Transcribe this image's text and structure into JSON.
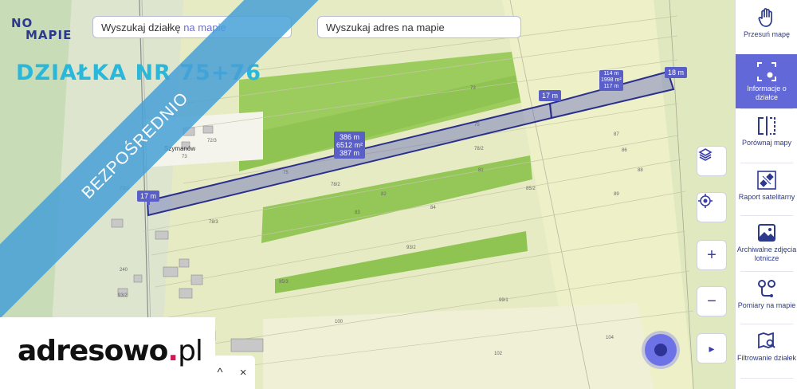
{
  "logo": {
    "line1": "NO",
    "line2": "MAPIE"
  },
  "search_parcel": {
    "prefix": "Wyszukaj działkę ",
    "highlight": "na mapie"
  },
  "search_address": {
    "text": "Wyszukaj adres na mapie"
  },
  "title": "DZIAŁKA NR 75+76",
  "ribbon": "BEZPOŚREDNIO",
  "place_name": "Szymanów",
  "measure_labels": {
    "left_edge": "17 m",
    "mid_edge": "17 m",
    "right_edge": "18 m",
    "parcel_a": [
      "386 m",
      "6512 m²",
      "387 m"
    ],
    "parcel_b": [
      "114 m",
      "1998 m²",
      "117 m"
    ]
  },
  "parcel_numbers": [
    "75",
    "76",
    "77",
    "78/2",
    "79",
    "80/2",
    "81",
    "82",
    "83",
    "84",
    "72/3",
    "73",
    "74",
    "73/2",
    "78/3",
    "85/2",
    "86",
    "87",
    "88",
    "89",
    "90",
    "240",
    "93/2",
    "95/3",
    "100",
    "102",
    "104"
  ],
  "map_controls": {
    "layers": "layers-icon",
    "locate": "locate-icon",
    "zoom_in": "+",
    "zoom_out": "−",
    "expand": "▸"
  },
  "brand": {
    "name": "adresowo",
    "dot": ".",
    "tld": "pl"
  },
  "mini_panel": {
    "up": "^",
    "close": "×"
  },
  "sidebar": {
    "items": [
      {
        "label": "Przesuń mapę",
        "icon": "hand-icon"
      },
      {
        "label": "Informacje o działce",
        "icon": "parcel-info-icon"
      },
      {
        "label": "Porównaj mapy",
        "icon": "compare-icon"
      },
      {
        "label": "Raport satelitarny",
        "icon": "satellite-icon"
      },
      {
        "label": "Archiwalne zdjęcia lotnicze",
        "icon": "photo-icon"
      },
      {
        "label": "Pomiary na mapie",
        "icon": "measure-icon"
      },
      {
        "label": "Filtrowanie działek",
        "icon": "filter-icon"
      }
    ]
  },
  "colors": {
    "accent": "#6268d8",
    "brand_navy": "#2d3a8c",
    "title_cyan": "#2ab7d9",
    "ribbon": "#46a0d7",
    "brand_dot": "#d4155a"
  }
}
